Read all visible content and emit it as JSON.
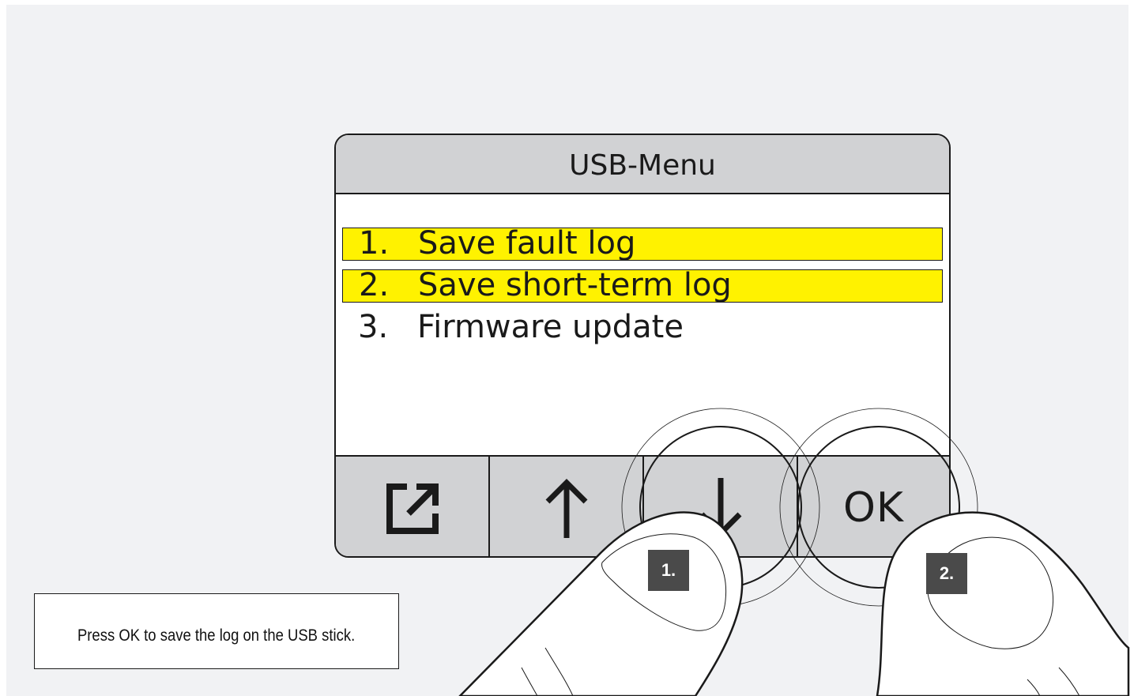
{
  "screen": {
    "title": "USB-Menu",
    "menu_items": [
      {
        "number": "1.",
        "label": "Save fault log",
        "highlighted": true
      },
      {
        "number": "2.",
        "label": "Save short-term log",
        "highlighted": true
      },
      {
        "number": "3.",
        "label": "Firmware update",
        "highlighted": false
      }
    ],
    "buttons": {
      "exit_icon": "exit-icon",
      "up_icon": "arrow-up-icon",
      "down_icon": "arrow-down-icon",
      "ok_label": "OK"
    }
  },
  "steps": {
    "step1_label": "1.",
    "step2_label": "2."
  },
  "instruction": "Press OK to save the log on the USB stick.",
  "colors": {
    "highlight": "#fff200",
    "panel": "#d1d2d4",
    "background": "#f1f2f4",
    "badge": "#4a4a4a"
  }
}
